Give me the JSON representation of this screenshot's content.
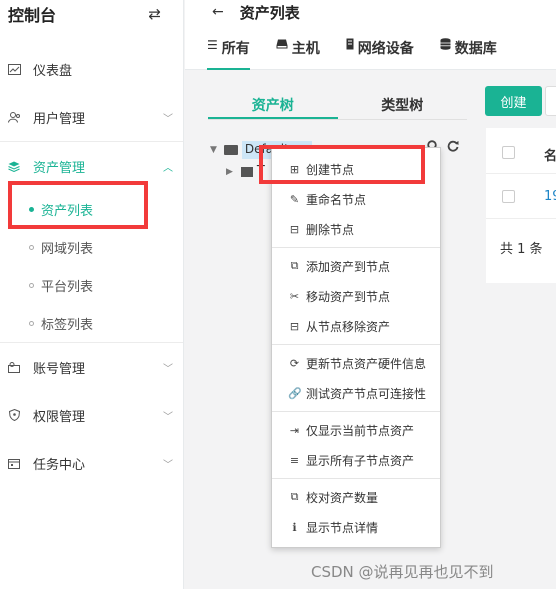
{
  "brand": {
    "title": "控制台",
    "swap_icon": "swap-icon"
  },
  "sidebar": {
    "items": [
      {
        "label": "仪表盘",
        "icon": "dashboard-icon"
      },
      {
        "label": "用户管理",
        "icon": "users-icon"
      },
      {
        "label": "资产管理",
        "icon": "layers-icon",
        "active": true
      },
      {
        "label": "账号管理",
        "icon": "account-icon"
      },
      {
        "label": "权限管理",
        "icon": "shield-icon"
      },
      {
        "label": "任务中心",
        "icon": "calendar-icon"
      }
    ],
    "sub_items": [
      {
        "label": "资产列表",
        "active": true
      },
      {
        "label": "网域列表"
      },
      {
        "label": "平台列表"
      },
      {
        "label": "标签列表"
      }
    ]
  },
  "header": {
    "title": "资产列表",
    "tabs": [
      {
        "label": "所有",
        "icon": "list-icon"
      },
      {
        "label": "主机",
        "icon": "host-icon"
      },
      {
        "label": "网络设备",
        "icon": "network-device-icon"
      },
      {
        "label": "数据库",
        "icon": "database-icon"
      }
    ]
  },
  "tree": {
    "tabs": [
      "资产树",
      "类型树"
    ],
    "root_label": "Default",
    "child_label": "T"
  },
  "table": {
    "create_label": "创建",
    "header_col": "名",
    "row_value": "19",
    "footer": "共 1 条"
  },
  "context_menu": {
    "groups": [
      [
        {
          "label": "创建节点",
          "icon": "plus-square-icon"
        },
        {
          "label": "重命名节点",
          "icon": "edit-icon"
        },
        {
          "label": "删除节点",
          "icon": "minus-square-icon"
        }
      ],
      [
        {
          "label": "添加资产到节点",
          "icon": "copy-icon"
        },
        {
          "label": "移动资产到节点",
          "icon": "scissors-icon"
        },
        {
          "label": "从节点移除资产",
          "icon": "minus-square-outline-icon"
        }
      ],
      [
        {
          "label": "更新节点资产硬件信息",
          "icon": "refresh-icon"
        },
        {
          "label": "测试资产节点可连接性",
          "icon": "link-icon"
        }
      ],
      [
        {
          "label": "仅显示当前节点资产",
          "icon": "indent-icon"
        },
        {
          "label": "显示所有子节点资产",
          "icon": "align-justify-icon"
        }
      ],
      [
        {
          "label": "校对资产数量",
          "icon": "copy-icon"
        },
        {
          "label": "显示节点详情",
          "icon": "info-icon"
        }
      ]
    ]
  },
  "watermark": "CSDN @说再见再也见不到",
  "colors": {
    "accent": "#1ab394",
    "highlight": "#f23a3a"
  }
}
